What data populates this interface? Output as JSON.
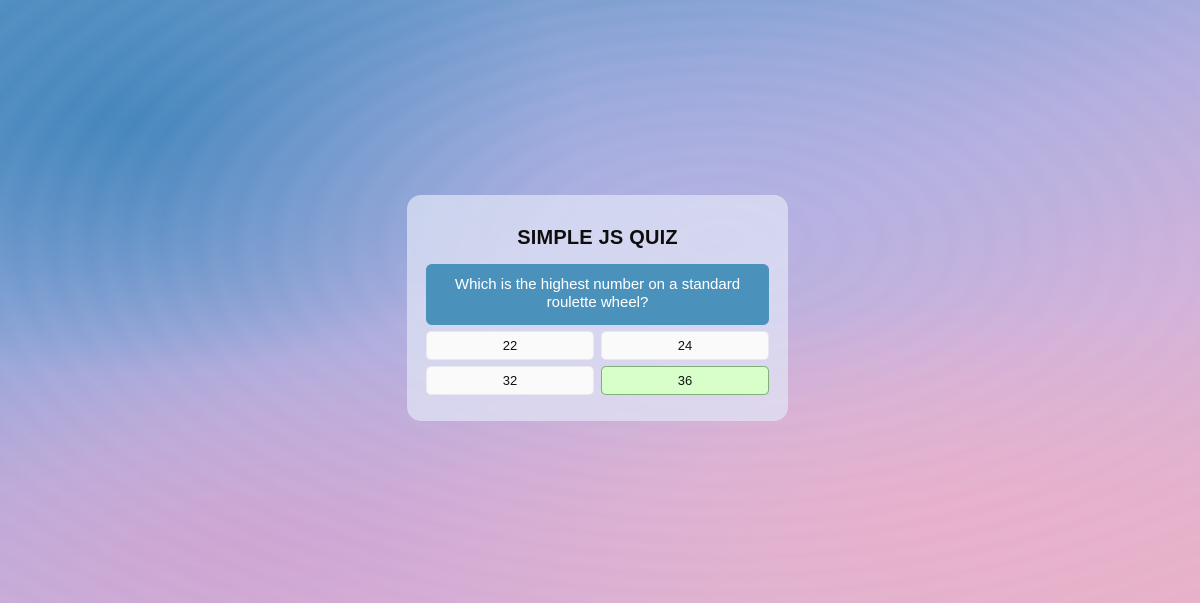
{
  "quiz": {
    "title": "SIMPLE JS QUIZ",
    "question": "Which is the highest number on a standard roulette wheel?",
    "answers": [
      {
        "label": "22",
        "state": "default"
      },
      {
        "label": "24",
        "state": "default"
      },
      {
        "label": "32",
        "state": "default"
      },
      {
        "label": "36",
        "state": "correct"
      }
    ]
  },
  "colors": {
    "question_bg": "#4a91bb",
    "answer_bg": "#fafafa",
    "correct_bg": "#d8ffc9",
    "correct_border": "#7fb07a"
  }
}
